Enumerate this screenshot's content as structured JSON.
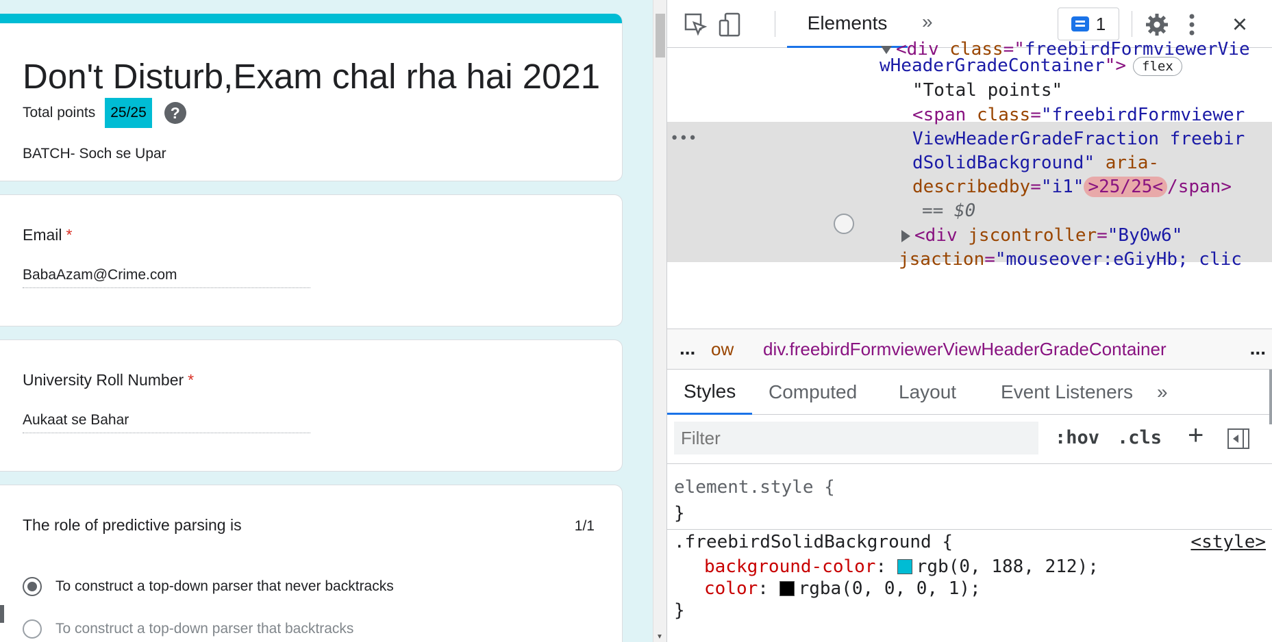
{
  "form": {
    "title": "Don't Disturb,Exam chal rha hai 2021",
    "total_points_label": "Total points",
    "grade": "25/25",
    "help_icon": "?",
    "description": "BATCH- Soch se Upar",
    "accent_color": "#00bcd4",
    "questions": [
      {
        "label": "Email",
        "required": "*",
        "answer": "BabaAzam@Crime.com"
      },
      {
        "label": "University Roll Number",
        "required": "*",
        "answer": "Aukaat se Bahar"
      },
      {
        "label": "The role of predictive parsing is",
        "points": "1/1",
        "options": [
          {
            "text": "To construct a top-down parser that never backtracks",
            "selected": true
          },
          {
            "text": "To construct a top-down parser that backtracks",
            "selected": false
          }
        ]
      }
    ]
  },
  "devtools": {
    "toolbar": {
      "inspect_icon": "inspect-element-icon",
      "device_icon": "device-toolbar-icon",
      "elements_tab": "Elements",
      "more_tabs": "»",
      "issues_count": "1",
      "settings_icon": "gear-icon",
      "menu_icon": "kebab-menu-icon",
      "close_icon": "×"
    },
    "dom": {
      "line1_tag": "<div",
      "line1_attr": "class",
      "line1_val": "freebirdFormviewerVie",
      "line2_val": "wHeaderGradeContainer",
      "line2_close": ">",
      "flex_badge": "flex",
      "text_node": "\"Total points\"",
      "span_open": "<span",
      "span_attr": "class",
      "span_val1": "\"freebirdFormviewer",
      "span_val2": "ViewHeaderGradeFraction freebir",
      "span_val3": "dSolidBackground\"",
      "span_attr2": "aria-",
      "span_attr2b": "describedby",
      "span_val4": "\"i1\"",
      "span_text": ">25/25<",
      "span_close": "/span>",
      "eq_var": "== $0",
      "div2_tag": "<div",
      "div2_attr": "jscontroller",
      "div2_val": "\"By0w6\"",
      "div2_attr2": "jsaction",
      "div2_val2": "\"mouseover:eGiyHb; clic"
    },
    "breadcrumb": {
      "left_more": "...",
      "prev": "ow",
      "current": "div.freebirdFormviewerViewHeaderGradeContainer",
      "right_more": "..."
    },
    "subtabs": [
      "Styles",
      "Computed",
      "Layout",
      "Event Listeners",
      "»"
    ],
    "filter": {
      "placeholder": "Filter",
      "hov": ":hov",
      "cls": ".cls",
      "add": "+"
    },
    "styles": {
      "element_style_open": "element.style {",
      "element_style_close": "}",
      "rule_selector": ".freebirdSolidBackground {",
      "rule_source": "<style>",
      "prop1": "background-color",
      "val1": "rgb(0, 188, 212);",
      "swatch1": "#00bcd4",
      "prop2": "color",
      "val2": "rgba(0, 0, 0, 1);",
      "swatch2": "#000000",
      "rule_close": "}"
    }
  }
}
